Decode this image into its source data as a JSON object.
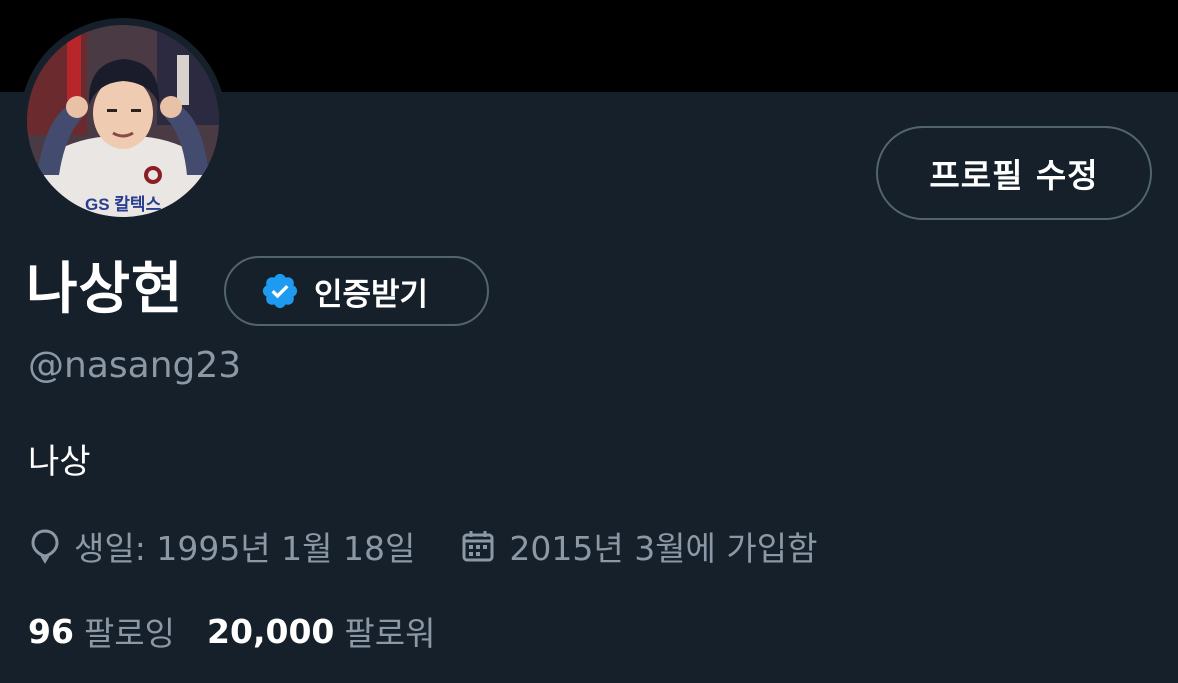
{
  "profile": {
    "name": "나상현",
    "handle": "@nasang23",
    "bio": "나상",
    "edit_button": "프로필 수정",
    "verify_button": "인증받기",
    "avatar_text": "GS 칼텍스",
    "birthday": "생일: 1995년 1월 18일",
    "joined": "2015년 3월에 가입함",
    "following_count": "96",
    "following_label": "팔로잉",
    "followers_count": "20,000",
    "followers_label": "팔로워"
  },
  "colors": {
    "background": "#15202b",
    "banner": "#000000",
    "verified_blue": "#1d9bf0",
    "secondary_text": "#8b98a5",
    "border": "#536471"
  },
  "icons": {
    "verified": "verified-badge-icon",
    "birthday": "balloon-icon",
    "joined": "calendar-icon"
  }
}
